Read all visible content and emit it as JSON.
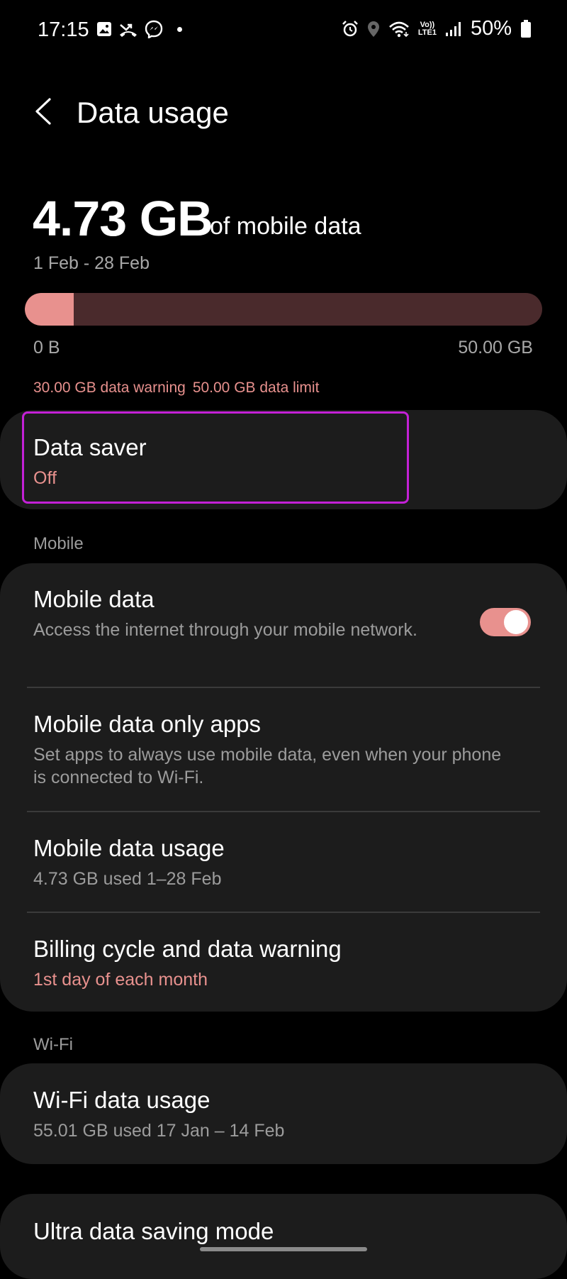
{
  "status_bar": {
    "time": "17:15",
    "battery": "50%",
    "left_icons": [
      "gallery-icon",
      "missed-call-icon",
      "messenger-icon"
    ],
    "right_icons": [
      "alarm-icon",
      "location-icon",
      "wifi-icon",
      "volte-icon",
      "signal-icon",
      "battery-icon"
    ],
    "volte_top": "Vo))",
    "volte_bottom": "LTE1"
  },
  "header": {
    "title": "Data usage"
  },
  "summary": {
    "amount": "4.73 GB",
    "suffix": "of mobile data",
    "range": "1 Feb - 28 Feb",
    "progress_fraction": 0.0946,
    "progress_min": "0 B",
    "progress_max": "50.00 GB",
    "warning": "30.00 GB data warning",
    "limit": "50.00 GB data limit"
  },
  "data_saver": {
    "title": "Data saver",
    "status": "Off"
  },
  "mobile_section": {
    "label": "Mobile",
    "items": [
      {
        "title": "Mobile data",
        "subtitle": "Access the internet through your mobile network.",
        "toggle_on": true
      },
      {
        "title": "Mobile data only apps",
        "subtitle": "Set apps to always use mobile data, even when your phone is connected to Wi-Fi."
      },
      {
        "title": "Mobile data usage",
        "subtitle": "4.73 GB used 1–28 Feb"
      },
      {
        "title": "Billing cycle and data warning",
        "subtitle": "1st day of each month"
      }
    ]
  },
  "wifi_section": {
    "label": "Wi-Fi",
    "items": [
      {
        "title": "Wi-Fi data usage",
        "subtitle": "55.01 GB used 17 Jan – 14 Feb"
      }
    ]
  },
  "extra": {
    "title": "Ultra data saving mode"
  },
  "colors": {
    "accent": "#e8918e",
    "track": "#4a2a2c",
    "card": "#1c1c1c",
    "highlight": "#c321d6",
    "background": "#000000"
  }
}
